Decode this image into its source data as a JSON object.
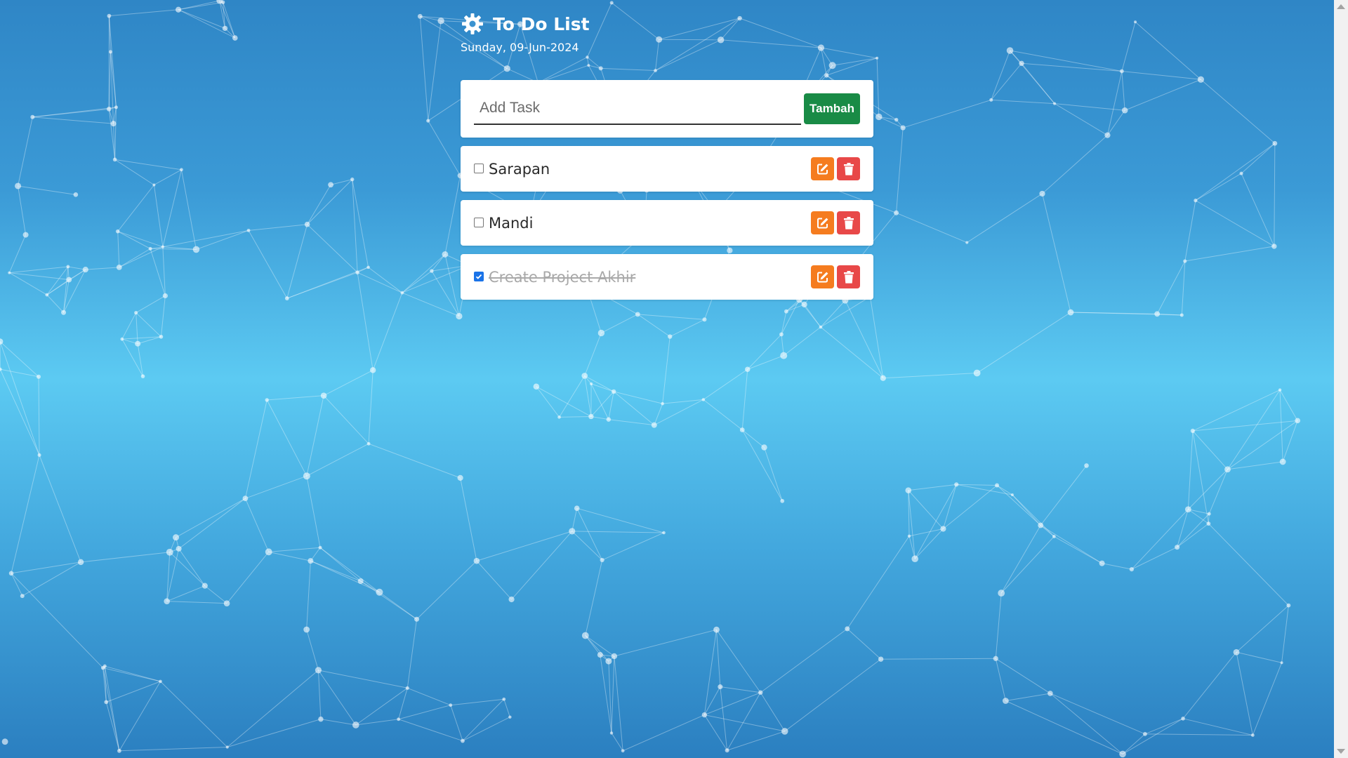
{
  "header": {
    "icon": "gear-icon",
    "title": "To Do List",
    "date": "Sunday, 09-Jun-2024"
  },
  "add_form": {
    "placeholder": "Add Task",
    "value": "",
    "button_label": "Tambah",
    "button_color": "#198b46"
  },
  "tasks": [
    {
      "label": "Sarapan",
      "checked": false
    },
    {
      "label": "Mandi",
      "checked": false
    },
    {
      "label": "Create Project Akhir",
      "checked": true
    }
  ],
  "actions": {
    "edit_icon": "edit-icon",
    "edit_color": "#f57c1f",
    "delete_icon": "trash-icon",
    "delete_color": "#e84848"
  },
  "background": {
    "style": "blue polygon network",
    "colors": [
      "#2f86c6",
      "#5ccaf2",
      "#2b7fc0"
    ]
  }
}
